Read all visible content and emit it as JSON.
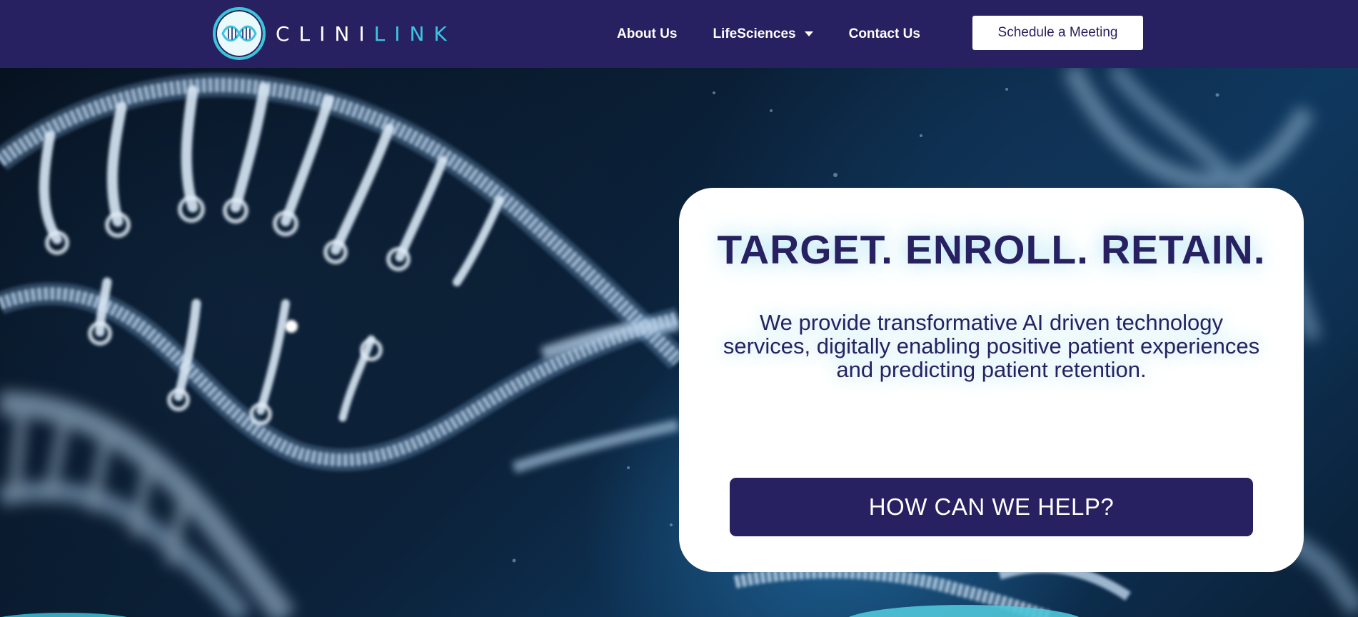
{
  "header": {
    "logo": {
      "text_a": "CLINI",
      "text_b": "LINK"
    },
    "nav": [
      {
        "label": "About Us"
      },
      {
        "label": "LifeSciences",
        "has_dropdown": true
      },
      {
        "label": "Contact Us"
      }
    ],
    "cta_label": "Schedule a Meeting"
  },
  "hero": {
    "headline": "TARGET. ENROLL. RETAIN.",
    "body": "We provide transformative AI driven technology services, digitally enabling positive patient experiences and predicting patient retention.",
    "cta_label": "HOW CAN WE HELP?"
  },
  "colors": {
    "brand_navy": "#272161",
    "brand_teal": "#3fc4e0",
    "white": "#ffffff"
  }
}
